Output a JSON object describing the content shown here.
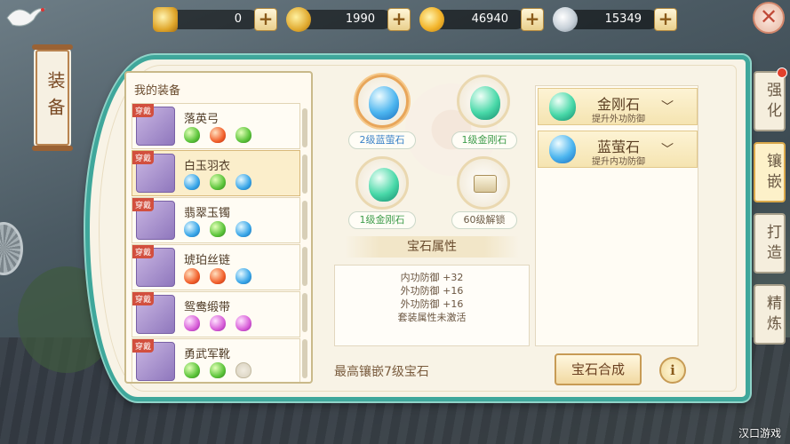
{
  "currencies": [
    {
      "icon": "gold-ingot-icon",
      "value": "0"
    },
    {
      "icon": "gold-coins-icon",
      "value": "1990"
    },
    {
      "icon": "gold-coin-icon",
      "value": "46940"
    },
    {
      "icon": "silver-coin-icon",
      "value": "15349"
    }
  ],
  "title": "装备",
  "equipment": {
    "header": "我的装备",
    "tag": "穿戴",
    "items": [
      {
        "name": "落英弓",
        "gems": [
          "green",
          "red",
          "green"
        ]
      },
      {
        "name": "白玉羽衣",
        "gems": [
          "blue",
          "green",
          "blue"
        ]
      },
      {
        "name": "翡翠玉镯",
        "gems": [
          "blue",
          "green",
          "blue"
        ]
      },
      {
        "name": "琥珀丝链",
        "gems": [
          "red",
          "red",
          "blue"
        ]
      },
      {
        "name": "鸳鸯缎带",
        "gems": [
          "pink",
          "pink",
          "pink"
        ]
      },
      {
        "name": "勇武军靴",
        "gems": [
          "green",
          "green",
          "empty"
        ]
      }
    ]
  },
  "slots": [
    {
      "label": "2级蓝萤石",
      "type": "blue"
    },
    {
      "label": "1级金刚石",
      "type": "green"
    },
    {
      "label": "1级金刚石",
      "type": "green"
    },
    {
      "label": "60级解锁",
      "type": "locked"
    }
  ],
  "attributes": {
    "title": "宝石属性",
    "lines": [
      "内功防御 +32",
      "外功防御 +16",
      "外功防御 +16",
      "套装属性未激活"
    ]
  },
  "max_text": "最高镶嵌7级宝石",
  "gem_list": [
    {
      "name": "金刚石",
      "desc": "提升外功防御",
      "color": "green"
    },
    {
      "name": "蓝萤石",
      "desc": "提升内功防御",
      "color": "blue"
    }
  ],
  "synth_button": "宝石合成",
  "info_button": "i",
  "tabs": [
    "强化",
    "镶嵌",
    "打造",
    "精炼"
  ],
  "active_tab": "镶嵌",
  "close_symbol": "✕",
  "watermark": "汉口游戏"
}
